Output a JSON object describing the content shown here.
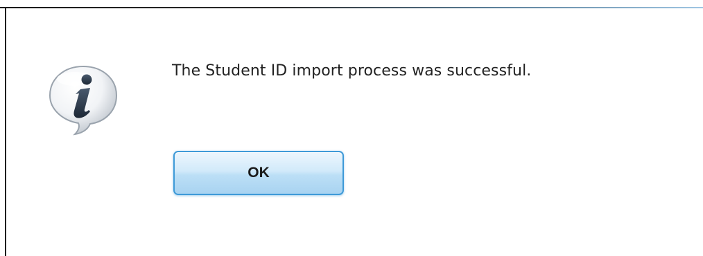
{
  "dialog": {
    "message": "The Student ID import process was successful.",
    "ok_label": "OK",
    "icon": "info-icon",
    "colors": {
      "button_border": "#3e9ad8",
      "button_fill_top": "#ecf6fd",
      "button_fill_bottom": "#a8d3f1",
      "text": "#222222"
    }
  }
}
